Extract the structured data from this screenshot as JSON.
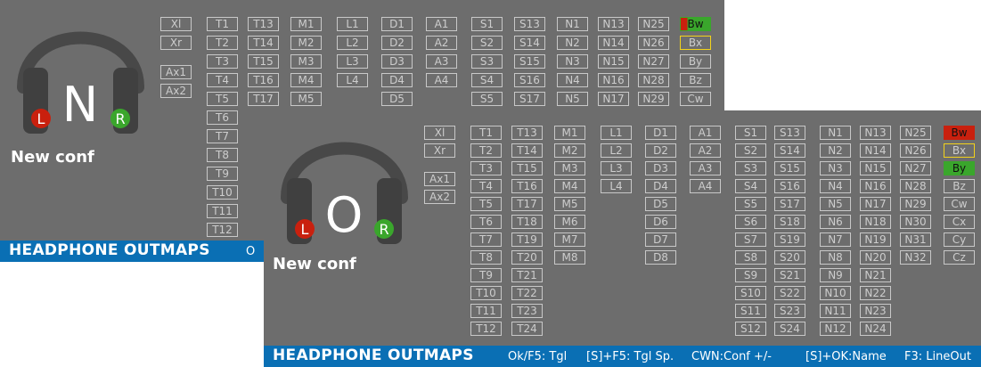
{
  "screen1": {
    "big_letter": "N",
    "left_badge": "L",
    "right_badge": "R",
    "conf_name": "New conf",
    "title": "HEADPHONE OUTMAPS",
    "hint_visible": "O",
    "buttons": {
      "left_group": [
        [
          "Xl",
          "Xr"
        ],
        [
          "Ax1",
          "Ax2"
        ]
      ],
      "t1": [
        "T1",
        "T2",
        "T3",
        "T4",
        "T5",
        "T6",
        "T7",
        "T8",
        "T9",
        "T10",
        "T11",
        "T12"
      ],
      "t2": [
        "T13",
        "T14",
        "T15",
        "T16",
        "T17"
      ],
      "m": [
        "M1",
        "M2",
        "M3",
        "M4",
        "M5"
      ],
      "l": [
        "L1",
        "L2",
        "L3",
        "L4"
      ],
      "d": [
        "D1",
        "D2",
        "D3",
        "D4",
        "D5"
      ],
      "a": [
        "A1",
        "A2",
        "A3",
        "A4"
      ],
      "s1": [
        "S1",
        "S2",
        "S3",
        "S4",
        "S5"
      ],
      "s2": [
        "S13",
        "S14",
        "S15",
        "S16",
        "S17"
      ],
      "n1": [
        "N1",
        "N2",
        "N3",
        "N4",
        "N5"
      ],
      "n2": [
        "N13",
        "N14",
        "N15",
        "N16",
        "N17"
      ],
      "n3": [
        "N25",
        "N26",
        "N27",
        "N28",
        "N29"
      ],
      "b": [
        "Bw",
        "Bx",
        "By",
        "Bz",
        "Cw"
      ]
    }
  },
  "screen2": {
    "big_letter": "O",
    "left_badge": "L",
    "right_badge": "R",
    "conf_name": "New conf",
    "title": "HEADPHONE OUTMAPS",
    "hints": [
      "Ok/F5: Tgl",
      "[S]+F5: Tgl Sp.",
      "CWN:Conf +/-",
      "[S]+OK:Name",
      "F3: LineOut"
    ],
    "buttons": {
      "left_group": [
        [
          "Xl",
          "Xr"
        ],
        [
          "Ax1",
          "Ax2"
        ]
      ],
      "t1": [
        "T1",
        "T2",
        "T3",
        "T4",
        "T5",
        "T6",
        "T7",
        "T8",
        "T9",
        "T10",
        "T11",
        "T12"
      ],
      "t2": [
        "T13",
        "T14",
        "T15",
        "T16",
        "T17",
        "T18",
        "T19",
        "T20",
        "T21",
        "T22",
        "T23",
        "T24"
      ],
      "m": [
        "M1",
        "M2",
        "M3",
        "M4",
        "M5",
        "M6",
        "M7",
        "M8"
      ],
      "l": [
        "L1",
        "L2",
        "L3",
        "L4"
      ],
      "d": [
        "D1",
        "D2",
        "D3",
        "D4",
        "D5",
        "D6",
        "D7",
        "D8"
      ],
      "a": [
        "A1",
        "A2",
        "A3",
        "A4"
      ],
      "s1": [
        "S1",
        "S2",
        "S3",
        "S4",
        "S5",
        "S6",
        "S7",
        "S8",
        "S9",
        "S10",
        "S11",
        "S12"
      ],
      "s2": [
        "S13",
        "S14",
        "S15",
        "S16",
        "S17",
        "S18",
        "S19",
        "S20",
        "S21",
        "S22",
        "S23",
        "S24"
      ],
      "n1": [
        "N1",
        "N2",
        "N3",
        "N4",
        "N5",
        "N6",
        "N7",
        "N8",
        "N9",
        "N10",
        "N11",
        "N12"
      ],
      "n2": [
        "N13",
        "N14",
        "N15",
        "N16",
        "N17",
        "N18",
        "N19",
        "N20",
        "N21",
        "N22",
        "N23",
        "N24"
      ],
      "n3": [
        "N25",
        "N26",
        "N27",
        "N28",
        "N29",
        "N30",
        "N31",
        "N32"
      ],
      "b": [
        "Bw",
        "Bx",
        "By",
        "Bz",
        "Cw",
        "Cx",
        "Cy",
        "Cz"
      ]
    }
  },
  "colors": {
    "panel": "#6d6d6d",
    "bar": "#0a6fb4",
    "active_red": "#c9200e",
    "active_green": "#3aa62c",
    "selected": "#f2d21b",
    "badge_l": "#c9200e",
    "badge_r": "#3aa62c"
  }
}
